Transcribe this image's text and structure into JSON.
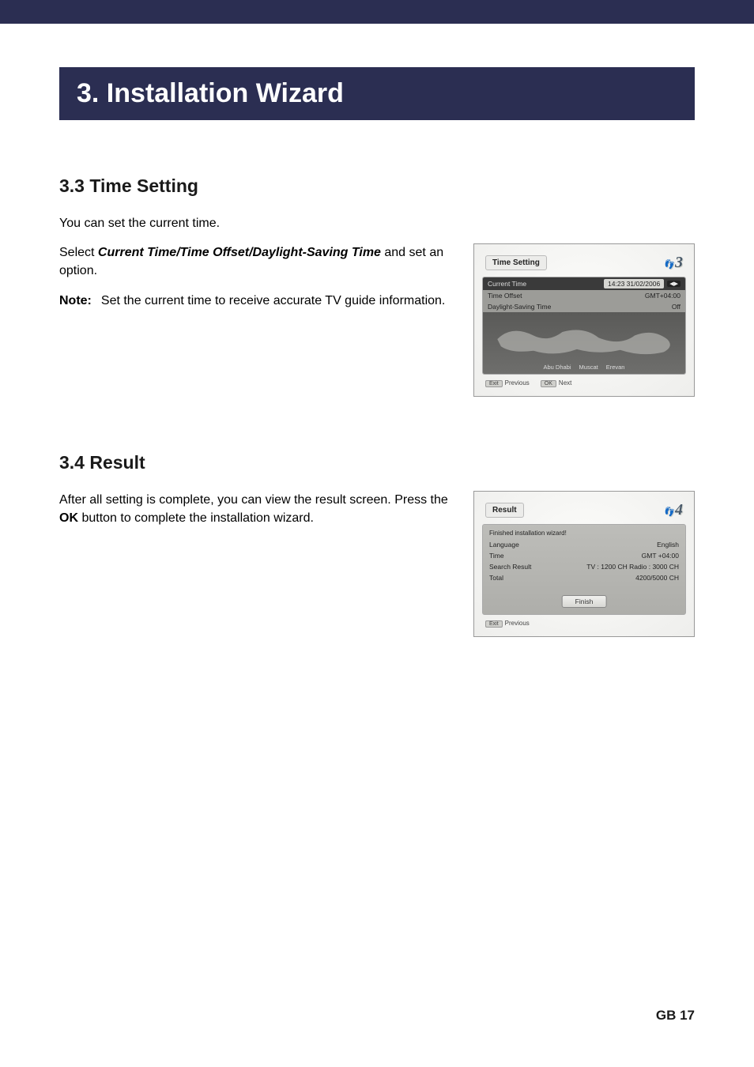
{
  "chapter_title": "3. Installation Wizard",
  "section_3_3": {
    "heading": "3.3 Time Setting",
    "intro": "You can set the current time.",
    "select_prefix": "Select ",
    "select_items": "Current Time/Time Offset/Daylight-Saving Time",
    "select_suffix": " and set an option.",
    "note_label": "Note:",
    "note_text": "Set the current time to receive accurate TV guide information."
  },
  "section_3_4": {
    "heading": "3.4 Result",
    "line1_a": "After all setting is complete, you can view the result screen. Press the ",
    "line1_ok": "OK",
    "line1_b": " button to complete the installation wizard."
  },
  "screenshot_time": {
    "title": "Time Setting",
    "step": "3",
    "rows": {
      "current_time_label": "Current Time",
      "current_time_value": "14:23 31/02/2006",
      "time_offset_label": "Time Offset",
      "time_offset_value": "GMT+04:00",
      "dst_label": "Daylight-Saving Time",
      "dst_value": "Off"
    },
    "cities": [
      "Abu Dhabi",
      "Muscat",
      "Erevan"
    ],
    "footer": {
      "exit_key": "Exit",
      "exit_label": "Previous",
      "ok_key": "OK",
      "ok_label": "Next"
    }
  },
  "screenshot_result": {
    "title": "Result",
    "step": "4",
    "group_label": "Finished installation wizard!",
    "rows": {
      "language_label": "Language",
      "language_value": "English",
      "time_label": "Time",
      "time_value": "GMT +04:00",
      "search_label": "Search Result",
      "search_value": "TV : 1200 CH  Radio : 3000 CH",
      "total_label": "Total",
      "total_value": "4200/5000 CH"
    },
    "finish_button": "Finish",
    "footer": {
      "exit_key": "Exit",
      "exit_label": "Previous"
    }
  },
  "page_number": "GB 17"
}
